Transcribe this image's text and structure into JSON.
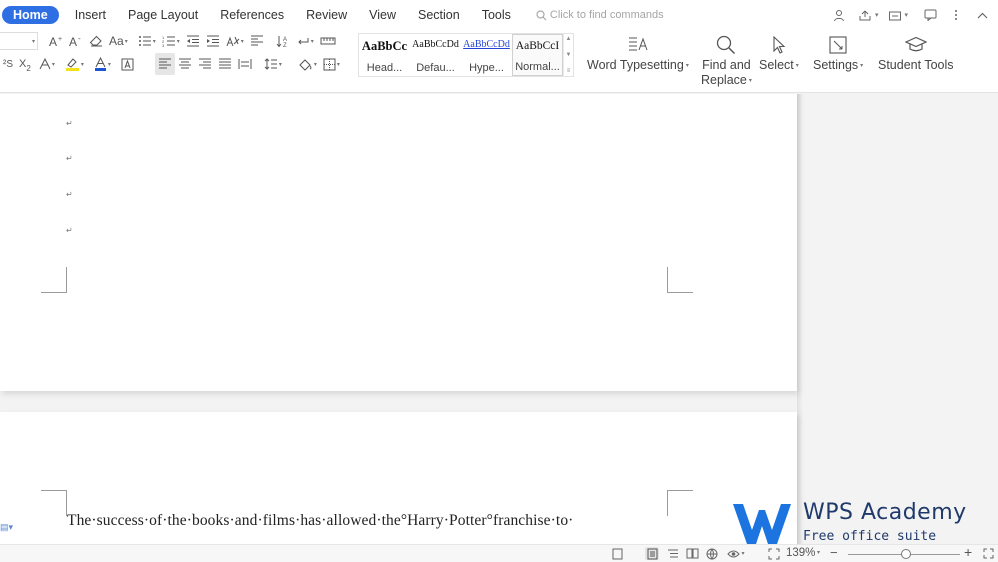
{
  "menu": {
    "tabs": [
      "Home",
      "Insert",
      "Page Layout",
      "References",
      "Review",
      "View",
      "Section",
      "Tools"
    ],
    "search_placeholder": "Click to find commands"
  },
  "ribbon": {
    "styles": [
      {
        "sample": "AaBbCc",
        "name": "Head..."
      },
      {
        "sample": "AaBbCcDd",
        "name": "Defau..."
      },
      {
        "sample": "AaBbCcDd",
        "name": "Hype..."
      },
      {
        "sample": "AaBbCcI",
        "name": "Normal..."
      }
    ],
    "word_typesetting": "Word Typesetting",
    "find_replace_line1": "Find and",
    "find_replace_line2": "Replace",
    "select": "Select",
    "settings": "Settings",
    "student_tools": "Student Tools",
    "font_style_label": "Aa"
  },
  "document": {
    "paragraph_mark": "↵",
    "body_line": "The·success·of·the·books·and·films·has·allowed·the°Harry·Potter°franchise·to·"
  },
  "watermark": {
    "title": "WPS Academy",
    "subtitle": "Free office suite tutorials"
  },
  "status": {
    "zoom_label": "139%",
    "zoom_fraction": 0.52
  },
  "colors": {
    "accent": "#2f6fe4",
    "font_color_bar": "#1a56d6",
    "highlight_bar": "#f5e11b",
    "watermark_blue": "#1b74e0"
  }
}
